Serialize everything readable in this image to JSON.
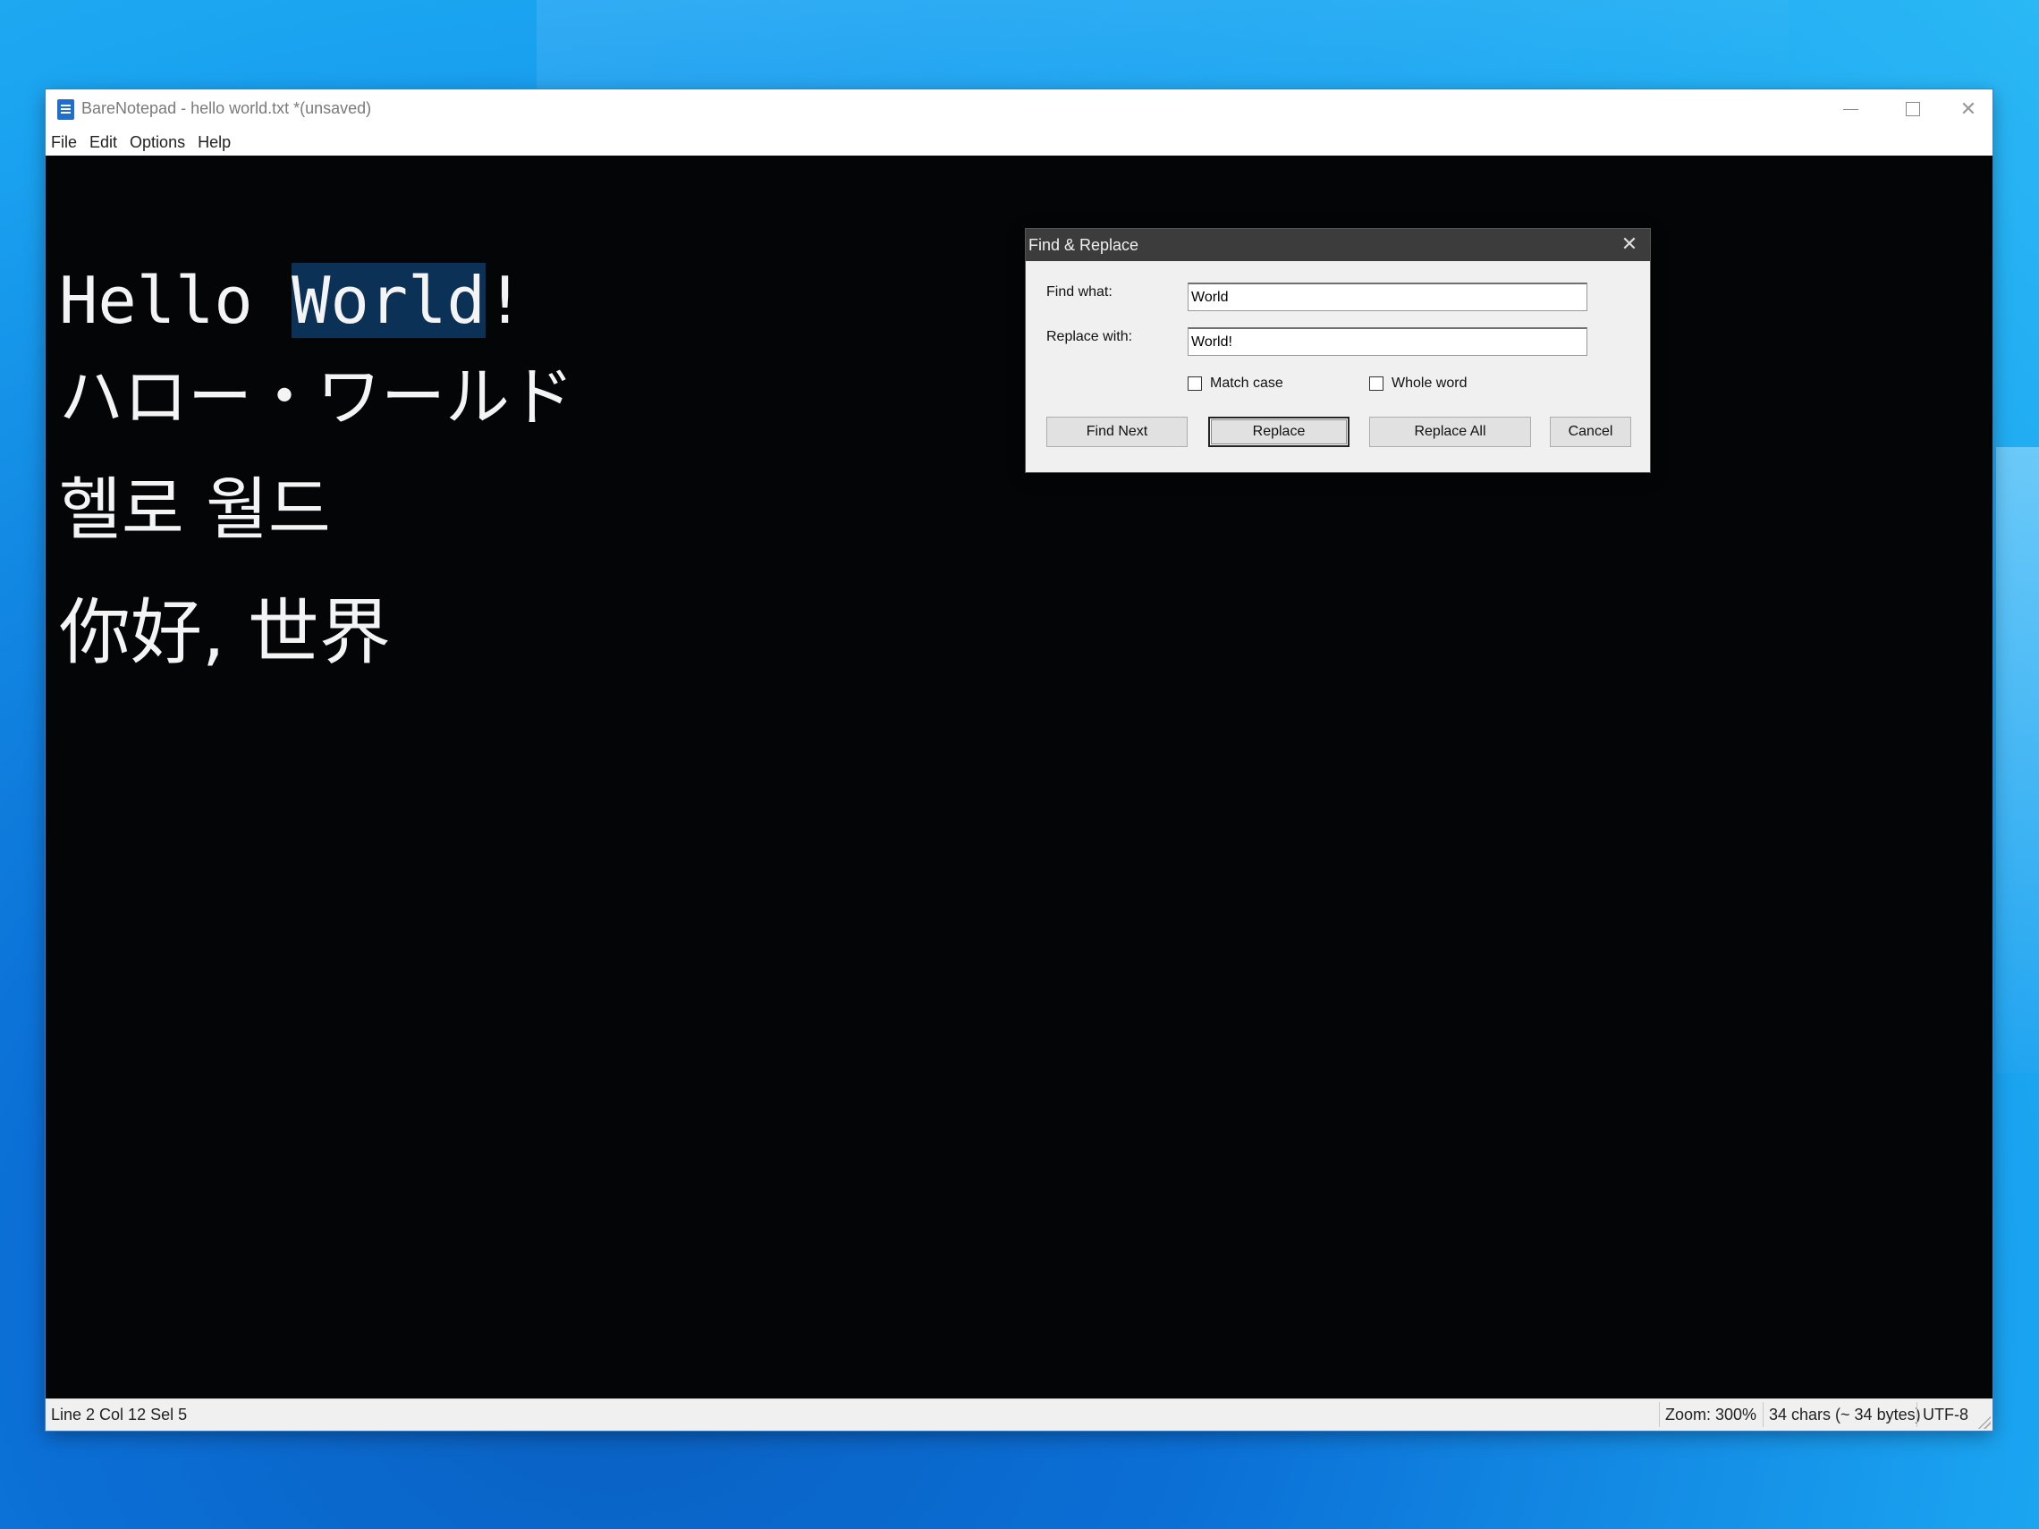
{
  "window": {
    "title": "BareNotepad - hello world.txt *(unsaved)"
  },
  "menu": [
    "File",
    "Edit",
    "Options",
    "Help"
  ],
  "editor": {
    "line1_before": "Hello ",
    "line1_selected": "World",
    "line1_after": "!",
    "line2": "ハロー・ワールド",
    "line3": "헬로 월드",
    "line4": "你好, 世界"
  },
  "statusbar": {
    "position": "Line 2  Col 12  Sel 5",
    "zoom": "Zoom: 300%",
    "chars": "34 chars (~ 34 bytes)",
    "encoding": "UTF-8"
  },
  "dialog": {
    "title": "Find & Replace",
    "find_label": "Find what:",
    "find_value": "World",
    "replace_label": "Replace with:",
    "replace_value": "World!",
    "match_case_label": "Match case",
    "match_case_checked": false,
    "whole_word_label": "Whole word",
    "whole_word_checked": false,
    "buttons": {
      "find_next": "Find Next",
      "replace": "Replace",
      "replace_all": "Replace All",
      "cancel": "Cancel"
    }
  },
  "colors": {
    "editor_bg": "#040507",
    "editor_text": "#f4f4f4",
    "selection": "#0b3156",
    "dialog_title_bg": "#3c3c3c"
  }
}
